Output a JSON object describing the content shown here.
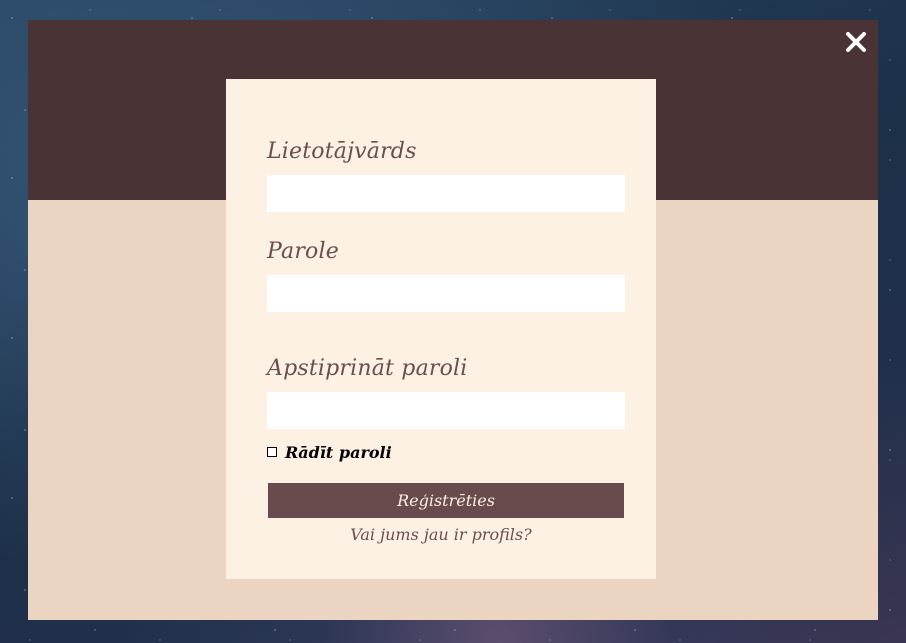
{
  "form": {
    "username_label": "Lietotājvārds",
    "username_value": "",
    "password_label": "Parole",
    "password_value": "",
    "confirm_password_label": "Apstiprināt paroli",
    "confirm_password_value": "",
    "show_password_label": "Rādīt paroli",
    "show_password_checked": false,
    "submit_label": "Reģistrēties",
    "login_link": "Vai jums jau ir profils?"
  },
  "icons": {
    "close": "close-icon"
  },
  "colors": {
    "header_band": "#493335",
    "modal_background": "#ecd4c3",
    "card_background": "#fdf1e3",
    "button_background": "#6a4b4d",
    "label_text": "#6b4d4f"
  }
}
